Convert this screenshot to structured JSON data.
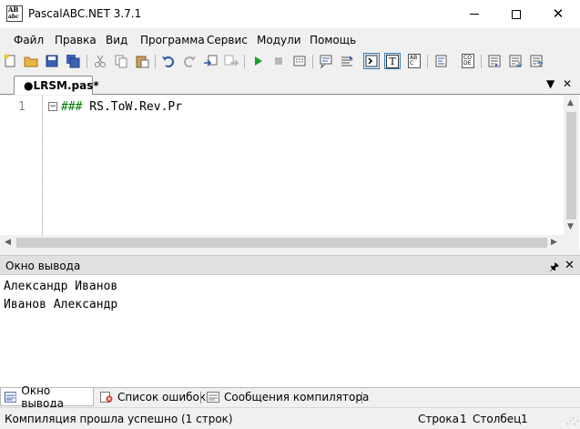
{
  "window": {
    "title": "PascalABC.NET 3.7.1",
    "icon_text": "AB",
    "icon_sub": "abc"
  },
  "menu": [
    "Файл",
    "Правка",
    "Вид",
    "Программа",
    "Сервис",
    "Модули",
    "Помощь"
  ],
  "toolbar": {
    "icons": [
      "new-file-icon",
      "open-folder-icon",
      "save-icon",
      "save-all-icon",
      "cut-icon",
      "copy-icon",
      "paste-icon",
      "undo-icon",
      "redo-icon",
      "import-icon",
      "export-icon",
      "run-icon",
      "stop-icon",
      "debug-icon",
      "comment-icon",
      "uncomment-icon",
      "console-icon",
      "text-icon",
      "abc-icon",
      "format-icon",
      "code-icon",
      "trace-1-icon",
      "trace-2-icon",
      "trace-3-icon"
    ],
    "labels": {
      "text": "T",
      "abc": "ABC",
      "code": "CO DE"
    }
  },
  "editor_tab": {
    "label": "●LRSM.pas*"
  },
  "editor": {
    "line_number": "1",
    "code_prefix": "###",
    "code_text": " RS.ToW.Rev.Pr"
  },
  "output_window": {
    "title": "Окно вывода",
    "lines": [
      "Александр Иванов",
      "Иванов Александр"
    ]
  },
  "bottom_tabs": [
    "Окно вывода",
    "Список ошибок",
    "Сообщения компилятора"
  ],
  "status": {
    "message": "Компиляция прошла успешно (1 строк)",
    "row_label": "Строка",
    "row_value": "1",
    "col_label": "Столбец",
    "col_value": "1"
  },
  "colors": {
    "accent": "#3c7fb1",
    "code_green": "#007a00",
    "run_green": "#1a9c2a"
  }
}
